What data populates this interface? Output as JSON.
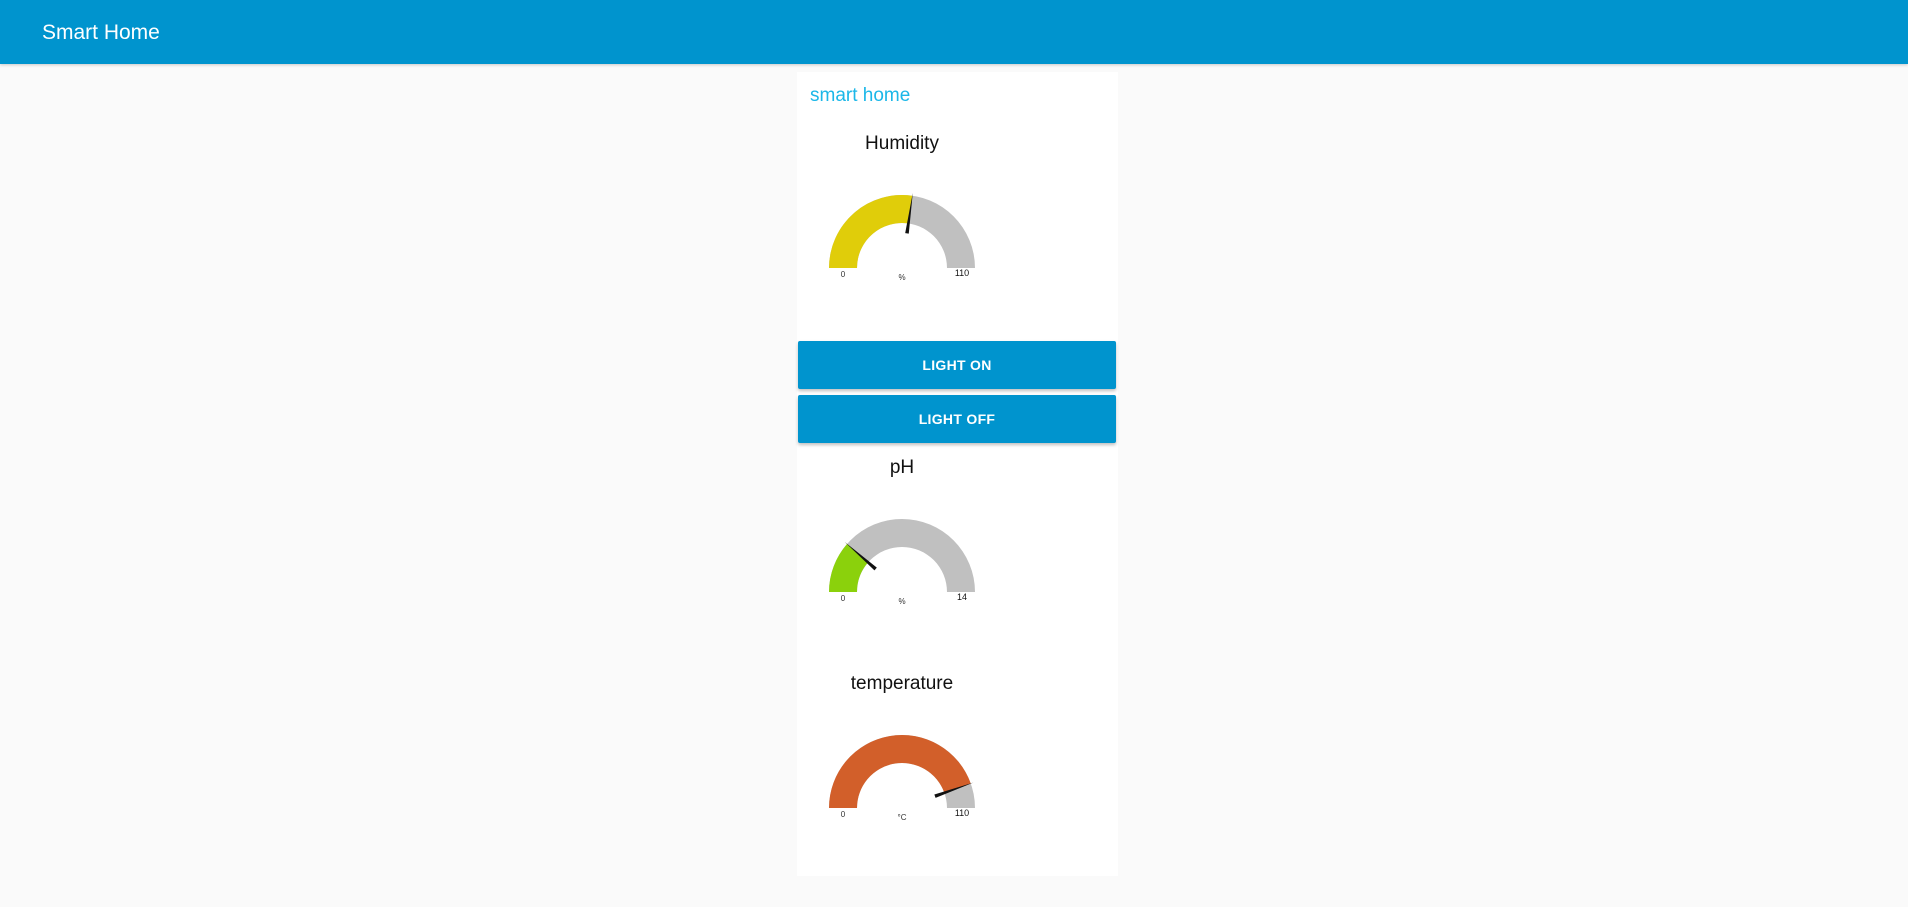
{
  "app": {
    "title": "Smart Home"
  },
  "group": {
    "title": "smart home"
  },
  "colors": {
    "header": "#0094ce",
    "button": "#0094ce",
    "group_title": "#1bb7e8",
    "track": "#c0c0c0",
    "humidity_fill": "#e0cd0a",
    "ph_fill": "#8bd10c",
    "temperature_fill": "#d25f2a"
  },
  "gauges": [
    {
      "id": "humidity",
      "title": "Humidity",
      "min": 0,
      "max": 110,
      "value": 60,
      "min_label": "0",
      "max_label": "110",
      "units": "%"
    },
    {
      "id": "ph",
      "title": "pH",
      "min": 0,
      "max": 14,
      "value": 3.2,
      "min_label": "0",
      "max_label": "14",
      "units": "%"
    },
    {
      "id": "temperature",
      "title": "temperature",
      "min": 0,
      "max": 110,
      "value": 98,
      "min_label": "0",
      "max_label": "110",
      "units": "°C"
    }
  ],
  "buttons": {
    "light_on": "LIGHT ON",
    "light_off": "LIGHT OFF"
  }
}
